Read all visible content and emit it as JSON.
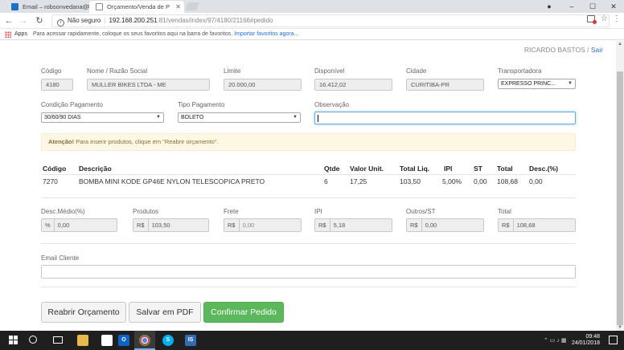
{
  "browser": {
    "tabs": [
      {
        "title": "Email – robsonvedana@"
      },
      {
        "title": "Orçamento/Venda de P"
      }
    ],
    "window_controls": {
      "minimize": "–",
      "maximize": "☐",
      "close": "✕"
    },
    "address": {
      "security": "Não seguro",
      "host": "192.168.200.251",
      "path": ":81/vendas/index/97/4180/21166#pedido"
    },
    "bookmarks": {
      "apps_label": "Apps",
      "hint": "Para acessar rapidamente, coloque os seus favoritos aqui na barra de favoritos.",
      "import_link": "Importar favoritos agora..."
    }
  },
  "user": {
    "name": "RICARDO BASTOS",
    "separator": "/",
    "logout": "Sair"
  },
  "form": {
    "codigo": {
      "label": "Código",
      "value": "4180"
    },
    "nome": {
      "label": "Nome / Razão Social",
      "value": "MULLER BIKES LTDA - ME"
    },
    "limite": {
      "label": "Limite",
      "value": "20.000,00"
    },
    "disponivel": {
      "label": "Disponível",
      "value": "16.412,02"
    },
    "cidade": {
      "label": "Cidade",
      "value": "CURITIBA-PR"
    },
    "transportadora": {
      "label": "Transportadora",
      "value": "EXPRESSO PRINC..."
    },
    "condicao": {
      "label": "Condição Pagamento",
      "value": "30/60/90 DIAS"
    },
    "tipo": {
      "label": "Tipo Pagamento",
      "value": "BOLETO"
    },
    "observacao": {
      "label": "Observação",
      "value": ""
    }
  },
  "alert": {
    "strong": "Atenção!",
    "text": "Para inserir produtos, clique em \"Reabrir orçamento\"."
  },
  "table": {
    "headers": [
      "Código",
      "Descrição",
      "Qtde",
      "Valor Unit.",
      "Total Liq.",
      "IPI",
      "ST",
      "Total",
      "Desc.(%)"
    ],
    "rows": [
      [
        "7270",
        "BOMBA MINI KODE GP46E NYLON TELESCOPICA PRETO",
        "6",
        "17,25",
        "103,50",
        "5,00%",
        "0,00",
        "108,68",
        "0,00"
      ]
    ]
  },
  "totals": {
    "desc_medio": {
      "label": "Desc.Médio(%)",
      "prefix": "%",
      "value": "0,00"
    },
    "produtos": {
      "label": "Produtos",
      "prefix": "R$",
      "value": "103,50"
    },
    "frete": {
      "label": "Frete",
      "prefix": "R$",
      "value": "0,00"
    },
    "ipi": {
      "label": "IPI",
      "prefix": "R$",
      "value": "5,18"
    },
    "outros": {
      "label": "Outros/ST",
      "prefix": "R$",
      "value": "0,00"
    },
    "total": {
      "label": "Total",
      "prefix": "R$",
      "value": "108,68"
    }
  },
  "email": {
    "label": "Email Cliente",
    "value": ""
  },
  "buttons": {
    "reabrir": "Reabrir Orçamento",
    "pdf": "Salvar em PDF",
    "confirmar": "Confirmar Pedido"
  },
  "taskbar": {
    "time": "09:48",
    "date": "24/01/2018",
    "apps": [
      {
        "icon": "outlook-icon",
        "label": "O"
      },
      {
        "icon": "chrome-icon",
        "label": ""
      },
      {
        "icon": "skype-icon",
        "label": "S"
      },
      {
        "icon": "app-is-icon",
        "label": "IS"
      }
    ]
  },
  "colors": {
    "primary_button": "#5cb85c",
    "alert_bg": "#fcf8e3",
    "link": "#2a76c7"
  }
}
